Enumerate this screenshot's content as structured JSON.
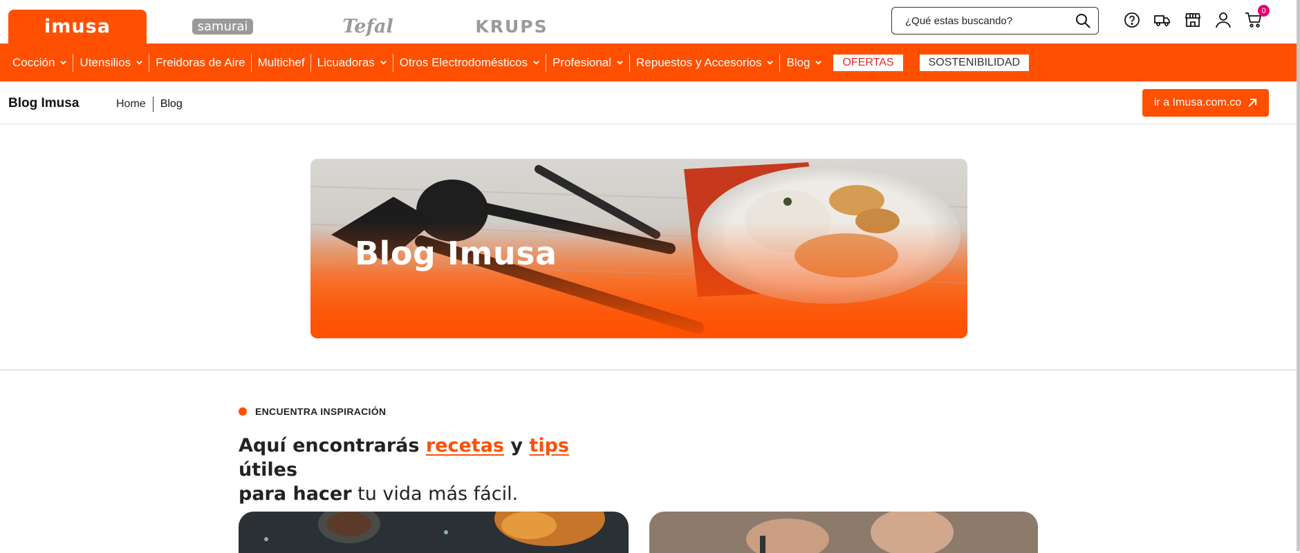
{
  "brands": {
    "imusa": "imusa",
    "samurai": "samurai",
    "tefal": "Tefal",
    "krups": "KRUPS"
  },
  "search": {
    "placeholder": "¿Qué estas buscando?"
  },
  "cart": {
    "count": "0"
  },
  "icons": [
    "help-icon",
    "truck-icon",
    "store-icon",
    "user-icon",
    "cart-icon"
  ],
  "nav": {
    "items": [
      {
        "label": "Cocción",
        "has_dropdown": true
      },
      {
        "label": "Utensilios",
        "has_dropdown": true
      },
      {
        "label": "Freidoras de Aire",
        "has_dropdown": false
      },
      {
        "label": "Multichef",
        "has_dropdown": false
      },
      {
        "label": "Licuadoras",
        "has_dropdown": true
      },
      {
        "label": "Otros Electrodomésticos",
        "has_dropdown": true
      },
      {
        "label": "Profesional",
        "has_dropdown": true
      },
      {
        "label": "Repuestos y Accesorios",
        "has_dropdown": true
      },
      {
        "label": "Blog",
        "has_dropdown": true
      }
    ],
    "ofertas": "OFERTAS",
    "sostenibilidad": "SOSTENIBILIDAD"
  },
  "subheader": {
    "title": "Blog Imusa",
    "breadcrumb": [
      "Home",
      "Blog"
    ],
    "goto_button": "ir a Imusa.com.co"
  },
  "hero": {
    "title": "Blog Imusa"
  },
  "inspiration": {
    "eyebrow": "ENCUENTRA INSPIRACIÓN",
    "headline_part1": "Aquí encontrarás ",
    "headline_recetas": "recetas",
    "headline_y": " y ",
    "headline_tips": "tips",
    "headline_part2": " útiles",
    "headline_line2_bold": "para hacer",
    "headline_line2_rest": " tu vida más fácil."
  },
  "colors": {
    "brand_orange": "#fe5000",
    "ofertas_red": "#e3262e",
    "cart_badge": "#e6006f"
  }
}
